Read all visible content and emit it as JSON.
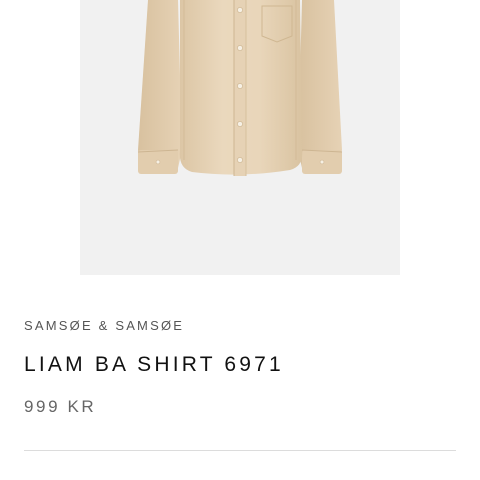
{
  "product": {
    "brand": "SAMSØE & SAMSØE",
    "name": "LIAM BA SHIRT 6971",
    "price": "999 KR",
    "image_background": "#f1f1f1",
    "shirt_color": "#e8d5b9"
  }
}
